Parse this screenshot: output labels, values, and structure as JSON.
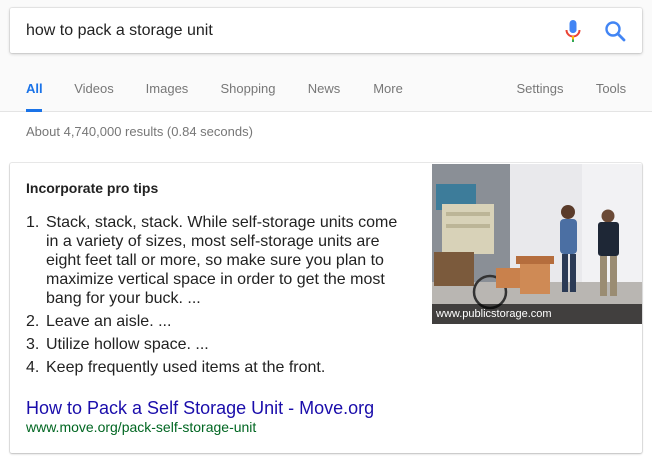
{
  "search": {
    "query": "how to pack a storage unit"
  },
  "tabs": {
    "left": [
      "All",
      "Videos",
      "Images",
      "Shopping",
      "News",
      "More"
    ],
    "right": [
      "Settings",
      "Tools"
    ]
  },
  "results_count": "About 4,740,000 results (0.84 seconds)",
  "snippet": {
    "heading": "Incorporate pro tips",
    "items": [
      {
        "num": "1.",
        "text": "Stack, stack, stack. While self-storage units come in a variety of sizes, most self-storage units are eight feet tall or more, so make sure you plan to maximize vertical space in order to get the most bang for your buck. ..."
      },
      {
        "num": "2.",
        "text": "Leave an aisle. ..."
      },
      {
        "num": "3.",
        "text": "Utilize hollow space. ..."
      },
      {
        "num": "4.",
        "text": "Keep frequently used items at the front."
      }
    ],
    "image_caption": "www.publicstorage.com",
    "result_title": "How to Pack a Self Storage Unit - Move.org",
    "result_url": "www.move.org/pack-self-storage-unit"
  },
  "colors": {
    "accent": "#1a73e8",
    "link": "#1a0dab",
    "url_green": "#006621",
    "muted": "#777777"
  },
  "icons": [
    "mic-icon",
    "search-icon"
  ]
}
